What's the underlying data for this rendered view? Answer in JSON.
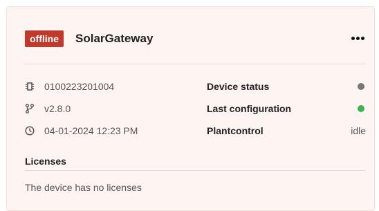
{
  "card": {
    "status_badge": "offline",
    "device_name": "SolarGateway",
    "more_icon": "more-horizontal-icon"
  },
  "info": {
    "serial": "0100223201004",
    "version": "v2.8.0",
    "timestamp": "04-01-2024 12:23 PM",
    "serial_icon": "chip-icon",
    "version_icon": "branch-icon",
    "timestamp_icon": "clock-icon"
  },
  "status": {
    "device_status_label": "Device status",
    "device_status_color": "#777777",
    "last_configuration_label": "Last configuration",
    "last_configuration_color": "#3cb54a",
    "plantcontrol_label": "Plantcontrol",
    "plantcontrol_value": "idle"
  },
  "licenses": {
    "title": "Licenses",
    "empty_text": "The device has no licenses"
  },
  "colors": {
    "badge_bg": "#c0392b",
    "card_bg": "#fef4f2"
  }
}
